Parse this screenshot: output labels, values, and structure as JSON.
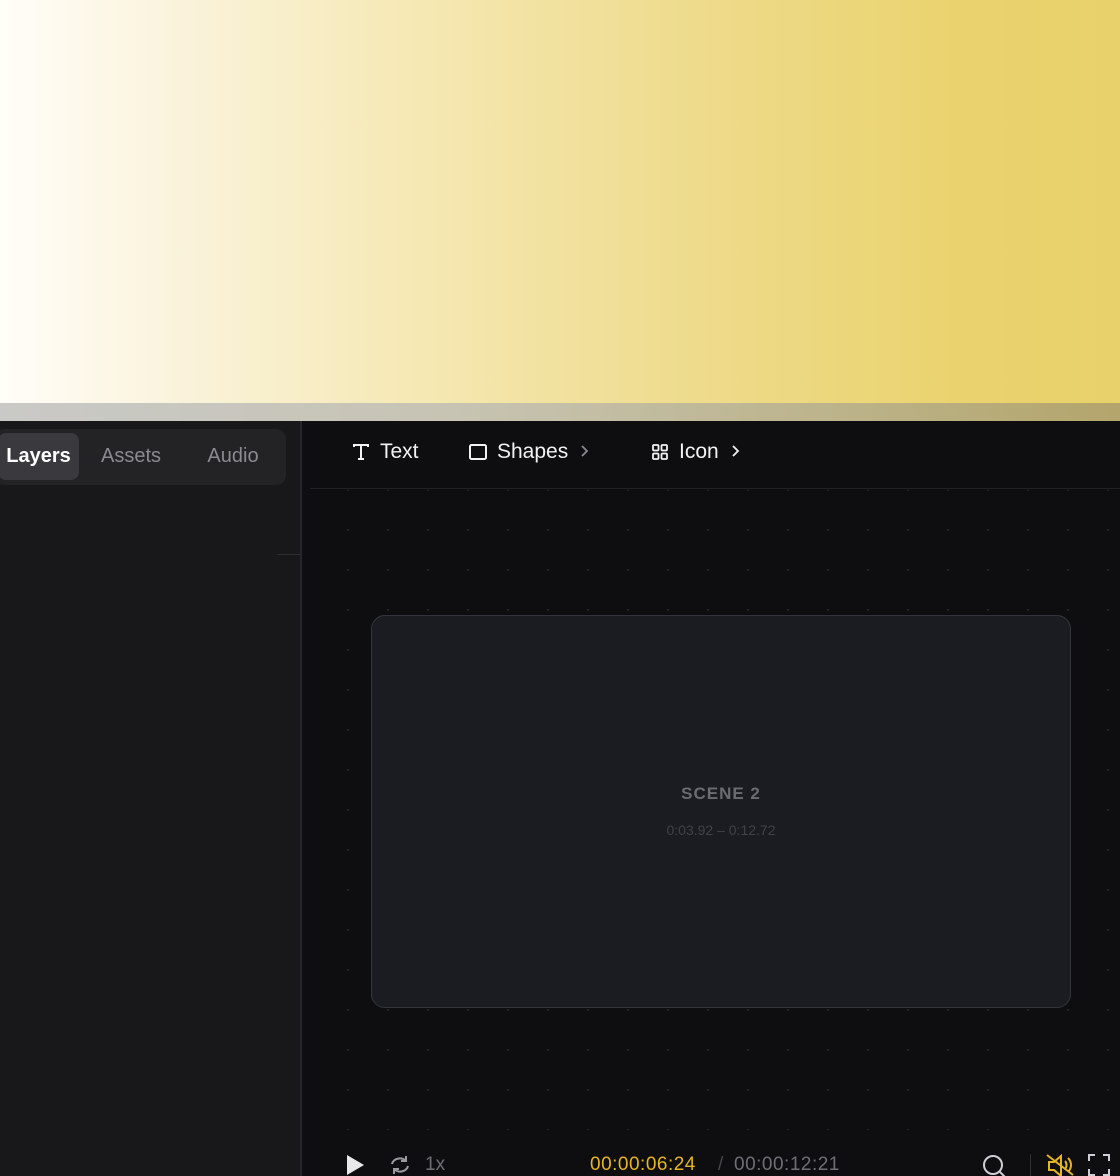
{
  "tabs": [
    {
      "label": "Layers",
      "active": true
    },
    {
      "label": "Assets",
      "active": false
    },
    {
      "label": "Audio",
      "active": false
    }
  ],
  "toolbar": {
    "text": {
      "label": "Text",
      "icon": "text-icon"
    },
    "shapes": {
      "label": "Shapes",
      "icon": "square-icon"
    },
    "icon": {
      "label": "Icon",
      "icon": "grid-icon"
    }
  },
  "scene": {
    "title": "SCENE 2",
    "range": "0:03.92 – 0:12.72"
  },
  "playback": {
    "speed": "1x",
    "current_time": "00:00:06:24",
    "separator": "/",
    "total_time": "00:00:12:21",
    "muted": true
  },
  "colors": {
    "accent": "#e6b523",
    "background": "#0e0e11",
    "sidebar": "#18181a",
    "scene": "#1b1c22"
  }
}
